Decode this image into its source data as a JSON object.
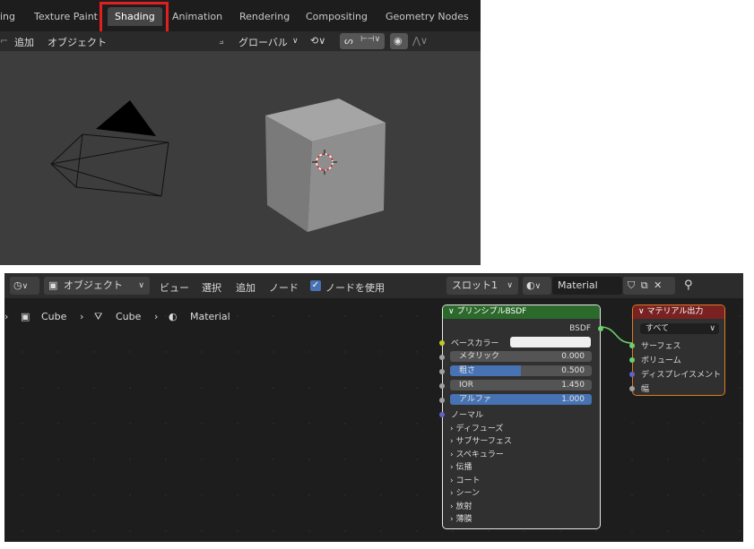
{
  "workspace_tabs": [
    "ing",
    "Texture Paint",
    "Shading",
    "Animation",
    "Rendering",
    "Compositing",
    "Geometry Nodes"
  ],
  "active_tab": "Shading",
  "viewport_header": {
    "add": "追加",
    "object": "オブジェクト",
    "orientation": "グローバル"
  },
  "node_header": {
    "mode": "オブジェクト",
    "view": "ビュー",
    "select": "選択",
    "add": "追加",
    "node": "ノード",
    "use_nodes": "ノードを使用",
    "slot": "スロット1",
    "material": "Material"
  },
  "breadcrumb": [
    "Cube",
    "Cube",
    "Material"
  ],
  "bsdf_node": {
    "title": "プリンシプルBSDF",
    "output": "BSDF",
    "base_color": "ベースカラー",
    "fields": [
      {
        "label": "メタリック",
        "value": "0.000",
        "fill": 0.0
      },
      {
        "label": "粗さ",
        "value": "0.500",
        "fill": 0.5
      },
      {
        "label": "IOR",
        "value": "1.450",
        "fill": 0.0
      },
      {
        "label": "アルファ",
        "value": "1.000",
        "fill": 1.0
      }
    ],
    "normal": "ノーマル",
    "panels": [
      "ディフューズ",
      "サブサーフェス",
      "スペキュラー",
      "伝播",
      "コート",
      "シーン",
      "放射",
      "薄膜"
    ]
  },
  "output_node": {
    "title": "マテリアル出力",
    "target": "すべて",
    "inputs": [
      "サーフェス",
      "ボリューム",
      "ディスプレイスメント",
      "幅"
    ]
  },
  "colors": {
    "accent": "#4772b3",
    "bsdf_header": "#2c6a2c",
    "output_header": "#7a2222",
    "highlight": "#e02020"
  }
}
